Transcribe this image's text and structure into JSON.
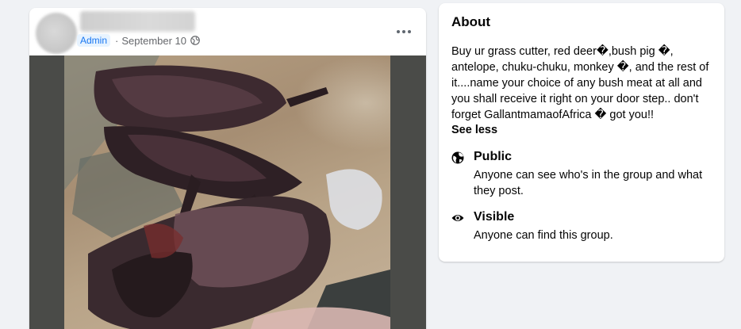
{
  "post": {
    "admin_badge": "Admin",
    "separator": "·",
    "date": "September 10",
    "privacy_icon": "globe-icon",
    "more_icon": "more-options-icon",
    "photo_description": "photo"
  },
  "about": {
    "title": "About",
    "description": "Buy ur grass cutter, red deer�,bush pig �, antelope, chuku-chuku, monkey �, and the rest of it....name your choice of any bush meat at all and you shall receive it right on your door step.. don't forget GallantmamaofAfrica � got you!!",
    "see_less": "See less",
    "public": {
      "icon": "globe-icon",
      "title": "Public",
      "description": "Anyone can see who's in the group and what they post."
    },
    "visible": {
      "icon": "eye-icon",
      "title": "Visible",
      "description": "Anyone can find this group."
    }
  },
  "colors": {
    "page_background": "#f0f2f5",
    "card_background": "#ffffff",
    "admin_badge_bg": "#e7f3ff",
    "admin_badge_text": "#1877f2",
    "secondary_text": "#65676b"
  }
}
